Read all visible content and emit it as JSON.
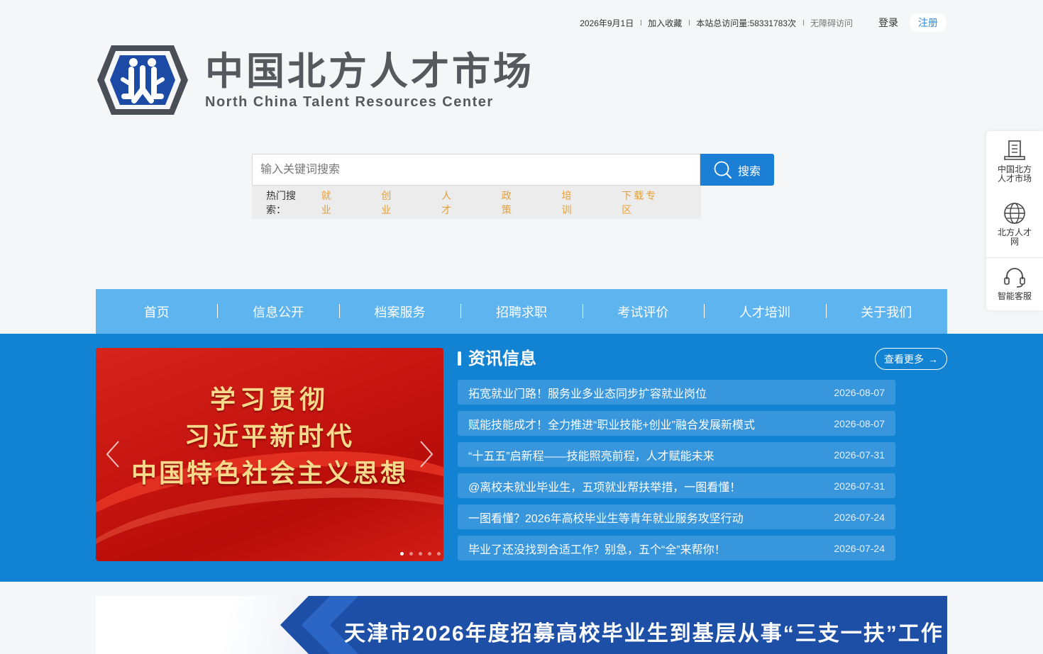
{
  "topbar": {
    "date": "2026年9月1日",
    "favorite": "加入收藏",
    "visits": "本站总访问量:58331783次",
    "accessibility": "无障碍访问",
    "login": "登录",
    "register": "注册"
  },
  "logo": {
    "cn": "中国北方人才市场",
    "en": "North China Talent Resources Center"
  },
  "search": {
    "placeholder": "输入关键词搜索",
    "button": "搜索",
    "hot_label": "热门搜索：",
    "hot_keywords": [
      "就 业",
      "创 业",
      "人 才",
      "政 策",
      "培 训",
      "下载专区"
    ]
  },
  "nav": {
    "items": [
      "首页",
      "信息公开",
      "档案服务",
      "招聘求职",
      "考试评价",
      "人才培训",
      "关于我们"
    ]
  },
  "carousel": {
    "line1": "学习贯彻",
    "line2": "习近平新时代",
    "line3": "中国特色社会主义思想",
    "dot_count": 5,
    "active_dot": 1
  },
  "news": {
    "title": "资讯信息",
    "more": "查看更多",
    "items": [
      {
        "title": "拓宽就业门路！服务业多业态同步扩容就业岗位",
        "date": "2026-08-07"
      },
      {
        "title": "赋能技能成才！全力推进“职业技能+创业”融合发展新模式",
        "date": "2026-08-07"
      },
      {
        "title": "“十五五”启新程——技能照亮前程，人才赋能未来",
        "date": "2026-07-31"
      },
      {
        "title": "@离校未就业毕业生，五项就业帮扶举措，一图看懂！",
        "date": "2026-07-31"
      },
      {
        "title": "一图看懂？2026年高校毕业生等青年就业服务攻坚行动",
        "date": "2026-07-24"
      },
      {
        "title": "毕业了还没找到合适工作？别急，五个“全”来帮你！",
        "date": "2026-07-24"
      }
    ]
  },
  "banner": {
    "text": "天津市2026年度招募高校毕业生到基层从事“三支一扶”工作"
  },
  "float": {
    "items": [
      {
        "label": "中国北方人才市场",
        "icon": "building-icon"
      },
      {
        "label": "北方人才网",
        "icon": "globe-icon"
      },
      {
        "label": "智能客服",
        "icon": "headset-icon"
      }
    ]
  },
  "colors": {
    "primary": "#1c7fd6",
    "nav": "#5eb4ee",
    "section": "#1282d2",
    "hot_keyword": "#e2a03a"
  }
}
